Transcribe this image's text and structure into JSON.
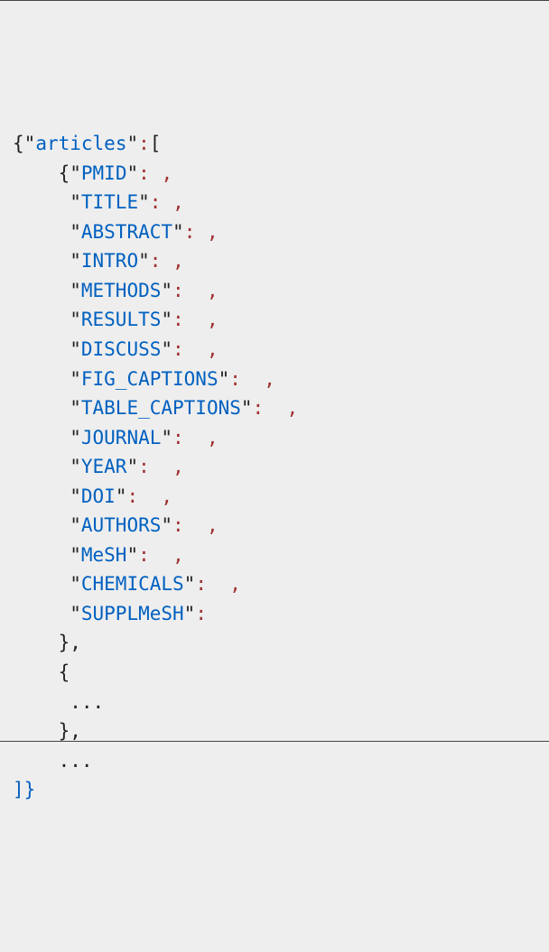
{
  "punct": {
    "lbrace": "{",
    "rbrace": "}",
    "lbracket": "[",
    "rbracket": "]",
    "quote": "\"",
    "comma": ",",
    "colon": ":",
    "ellipsis": "...",
    "close_brace_comma": "},",
    "close_array_brace": "]}"
  },
  "keys": {
    "articles": "articles",
    "pmid": "PMID",
    "title": "TITLE",
    "abstract": "ABSTRACT",
    "intro": "INTRO",
    "methods": "METHODS",
    "results": "RESULTS",
    "discuss": "DISCUSS",
    "fig_captions": "FIG_CAPTIONS",
    "table_captions": "TABLE_CAPTIONS",
    "journal": "JOURNAL",
    "year": "YEAR",
    "doi": "DOI",
    "authors": "AUTHORS",
    "mesh": "MeSH",
    "chemicals": "CHEMICALS",
    "supplmesh": "SUPPLMeSH"
  }
}
